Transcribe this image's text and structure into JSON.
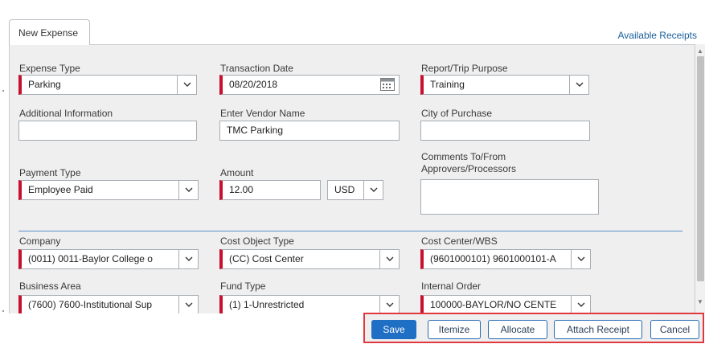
{
  "tab": {
    "label": "New Expense"
  },
  "available_receipts": "Available Receipts",
  "fields": {
    "expense_type": {
      "label": "Expense Type",
      "value": "Parking"
    },
    "transaction_date": {
      "label": "Transaction Date",
      "value": "08/20/2018"
    },
    "report_purpose": {
      "label": "Report/Trip Purpose",
      "value": "Training"
    },
    "additional_info": {
      "label": "Additional Information",
      "value": ""
    },
    "vendor_name": {
      "label": "Enter Vendor Name",
      "value": "TMC Parking"
    },
    "city": {
      "label": "City of Purchase",
      "value": ""
    },
    "payment_type": {
      "label": "Payment Type",
      "value": "Employee Paid"
    },
    "amount": {
      "label": "Amount",
      "value": "12.00"
    },
    "currency": {
      "value": "USD"
    },
    "comments": {
      "label_line1": "Comments To/From",
      "label_line2": "Approvers/Processors",
      "value": ""
    },
    "company": {
      "label": "Company",
      "value": "(0011) 0011-Baylor College o"
    },
    "cost_object_type": {
      "label": "Cost Object Type",
      "value": "(CC) Cost Center"
    },
    "cost_center": {
      "label": "Cost Center/WBS",
      "value": "(9601000101) 9601000101-A"
    },
    "business_area": {
      "label": "Business Area",
      "value": "(7600) 7600-Institutional Sup"
    },
    "fund_type": {
      "label": "Fund Type",
      "value": "(1) 1-Unrestricted"
    },
    "internal_order": {
      "label": "Internal Order",
      "value": "100000-BAYLOR/NO CENTE"
    }
  },
  "buttons": {
    "save": "Save",
    "itemize": "Itemize",
    "allocate": "Allocate",
    "attach_receipt": "Attach Receipt",
    "cancel": "Cancel"
  },
  "colors": {
    "required_marker": "#c8102e",
    "primary_button": "#1f6fc4",
    "link": "#1a5e9a",
    "highlight_border": "#e0383e"
  },
  "icons": [
    "chevron-down-icon",
    "calendar-icon",
    "scroll-up-icon",
    "scroll-down-icon"
  ]
}
